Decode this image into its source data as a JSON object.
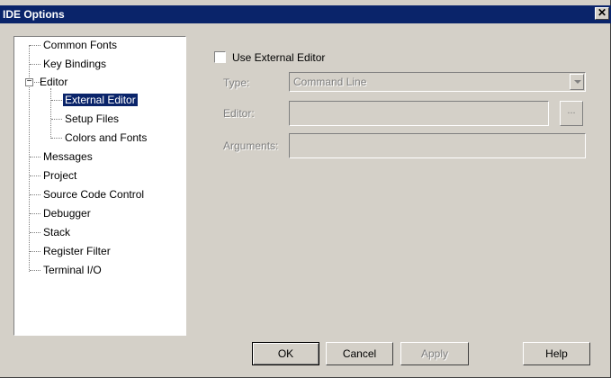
{
  "window": {
    "title": "IDE Options"
  },
  "tree": {
    "items": [
      {
        "label": "Common Fonts"
      },
      {
        "label": "Key Bindings"
      },
      {
        "label": "Editor"
      },
      {
        "label": "External Editor"
      },
      {
        "label": "Setup Files"
      },
      {
        "label": "Colors and Fonts"
      },
      {
        "label": "Messages"
      },
      {
        "label": "Project"
      },
      {
        "label": "Source Code Control"
      },
      {
        "label": "Debugger"
      },
      {
        "label": "Stack"
      },
      {
        "label": "Register Filter"
      },
      {
        "label": "Terminal I/O"
      }
    ],
    "expander_symbol": "−"
  },
  "panel": {
    "use_external_label": "Use External Editor",
    "type_label": "Type:",
    "type_value": "Command Line",
    "editor_label": "Editor:",
    "editor_value": "",
    "browse_label": "...",
    "arguments_label": "Arguments:",
    "arguments_value": ""
  },
  "buttons": {
    "ok": "OK",
    "cancel": "Cancel",
    "apply": "Apply",
    "help": "Help"
  }
}
